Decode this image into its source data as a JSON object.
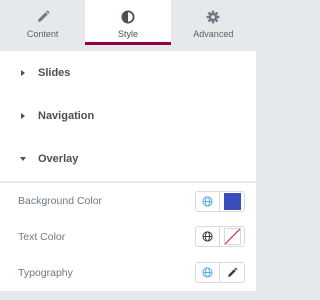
{
  "tabs": [
    {
      "label": "Content",
      "icon": "pencil-icon"
    },
    {
      "label": "Style",
      "icon": "contrast-icon",
      "active": true
    },
    {
      "label": "Advanced",
      "icon": "gear-icon"
    }
  ],
  "sections": [
    {
      "title": "Slides",
      "expanded": false
    },
    {
      "title": "Navigation",
      "expanded": false
    },
    {
      "title": "Overlay",
      "expanded": true
    }
  ],
  "controls": {
    "background_color": {
      "label": "Background Color",
      "value": "#3b4db8",
      "global_icon": "globe-icon"
    },
    "text_color": {
      "label": "Text Color",
      "value": "none",
      "global_icon": "globe-icon"
    },
    "typography": {
      "label": "Typography",
      "global_icon": "globe-icon",
      "edit_icon": "pencil-icon"
    }
  },
  "colors": {
    "active_tab_accent": "#93003f",
    "global_active": "#58b2e6",
    "global_inactive": "#3c3c3c",
    "unset_slash": "#d72b3f"
  }
}
